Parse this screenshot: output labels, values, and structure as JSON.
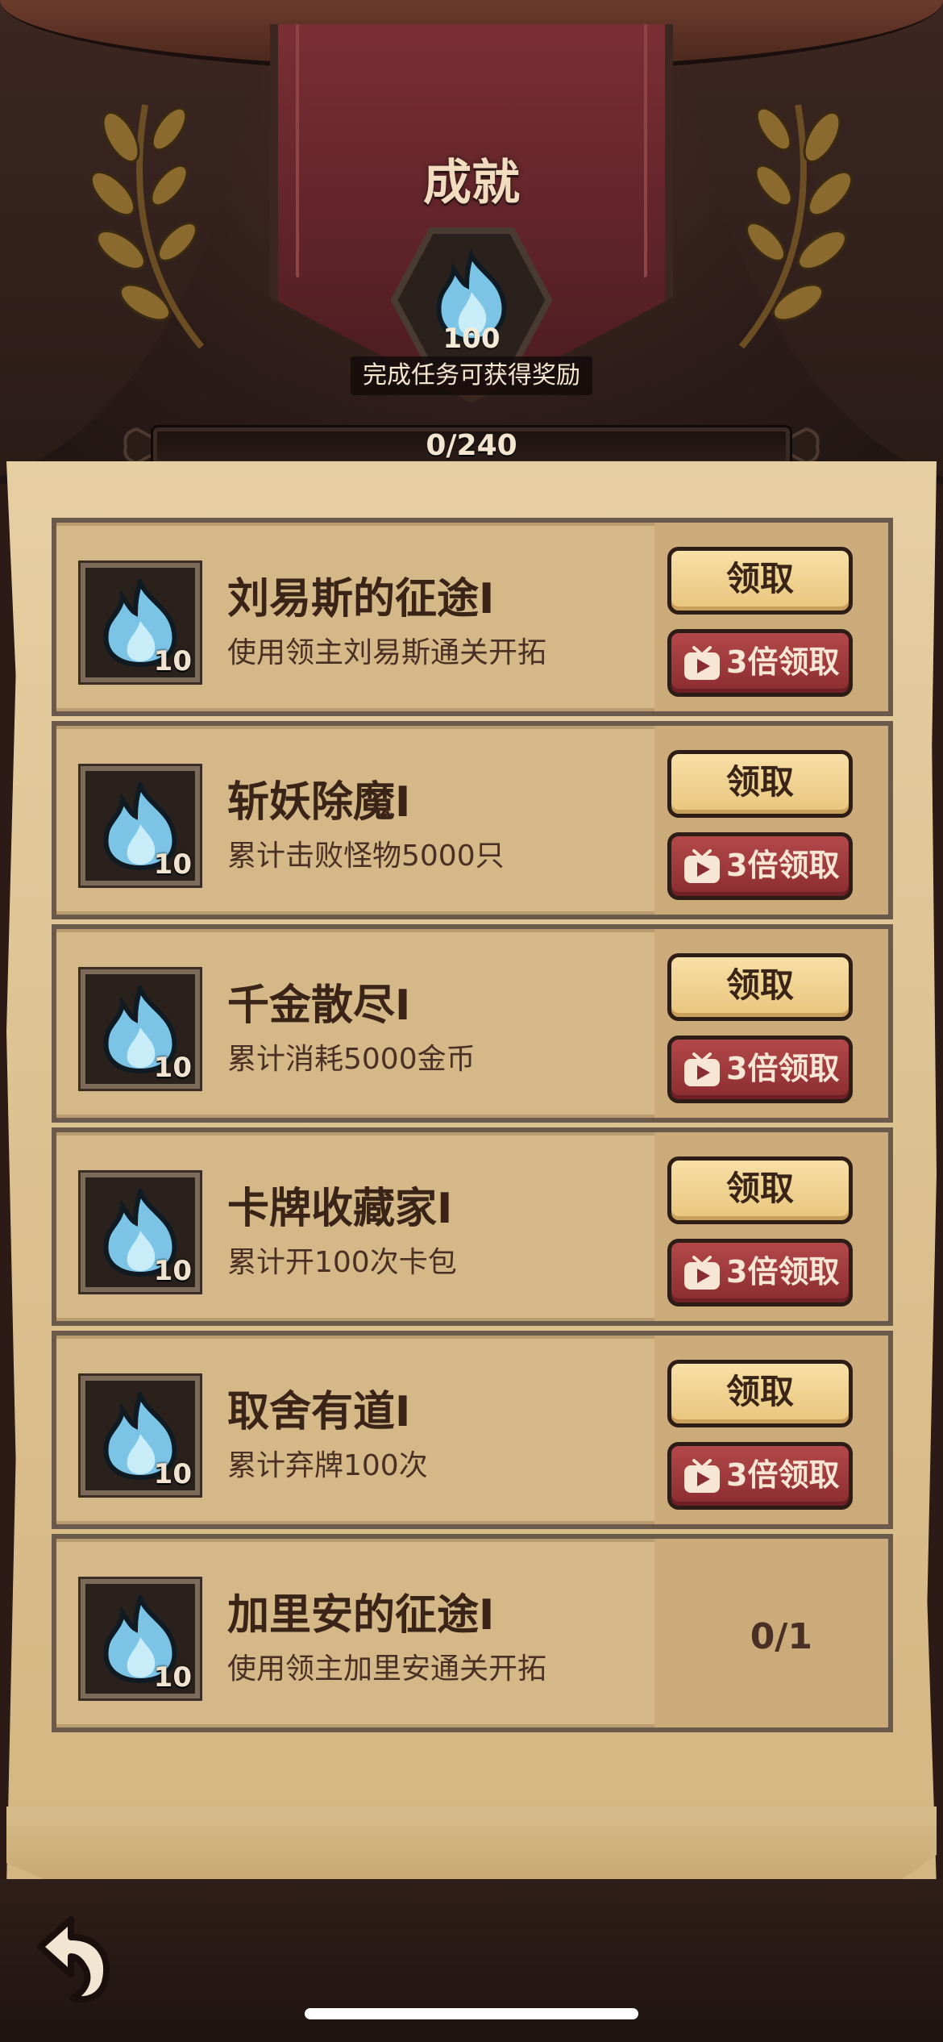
{
  "header": {
    "title": "成就",
    "reward_value": "100",
    "reward_hint": "完成任务可获得奖励",
    "progress_text": "0/240",
    "progress_fraction": 0
  },
  "achievements": [
    {
      "title": "刘易斯的征途I",
      "desc": "使用领主刘易斯通关开拓",
      "reward_count": "10",
      "claim_label": "领取",
      "triple_label": "3倍领取",
      "status": "claimable"
    },
    {
      "title": "斩妖除魔I",
      "desc": "累计击败怪物5000只",
      "reward_count": "10",
      "claim_label": "领取",
      "triple_label": "3倍领取",
      "status": "claimable"
    },
    {
      "title": "千金散尽I",
      "desc": "累计消耗5000金币",
      "reward_count": "10",
      "claim_label": "领取",
      "triple_label": "3倍领取",
      "status": "claimable"
    },
    {
      "title": "卡牌收藏家I",
      "desc": "累计开100次卡包",
      "reward_count": "10",
      "claim_label": "领取",
      "triple_label": "3倍领取",
      "status": "claimable"
    },
    {
      "title": "取舍有道I",
      "desc": "累计弃牌100次",
      "reward_count": "10",
      "claim_label": "领取",
      "triple_label": "3倍领取",
      "status": "claimable"
    },
    {
      "title": "加里安的征途I",
      "desc": "使用领主加里安通关开拓",
      "reward_count": "10",
      "progress": "0/1",
      "status": "in_progress"
    }
  ],
  "icons": {
    "reward": "blue-flame-icon",
    "video": "tv-play-icon",
    "back": "back-arrow-icon"
  },
  "colors": {
    "claim_button": "#e8c57c",
    "triple_button": "#8a2d30",
    "banner": "#5e2328",
    "parchment": "#dcc190",
    "flame": "#7cc4e6"
  }
}
